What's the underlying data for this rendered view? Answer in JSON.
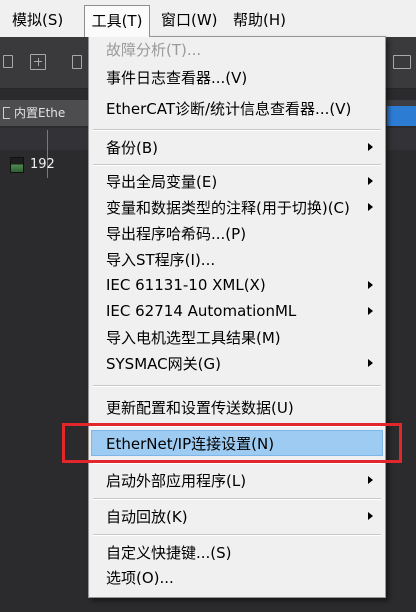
{
  "menubar": {
    "items": [
      {
        "label": "模拟(S)"
      },
      {
        "label": "工具(T)",
        "open": true
      },
      {
        "label": "窗口(W)"
      },
      {
        "label": "帮助(H)"
      }
    ]
  },
  "workspace": {
    "panel_tab_label": "内置Ethe",
    "device_row_text": "192"
  },
  "tools_menu": {
    "items": [
      {
        "label": "故障分析(T)...",
        "disabled": true
      },
      {
        "label": "事件日志查看器...(V)"
      },
      {
        "label": "EtherCAT诊断/统计信息查看器...(V)"
      },
      {
        "label": "备份(B)",
        "submenu": true
      },
      {
        "label": "导出全局变量(E)",
        "submenu": true
      },
      {
        "label": "变量和数据类型的注释(用于切换)(C)",
        "submenu": true
      },
      {
        "label": "导出程序哈希码...(P)"
      },
      {
        "label": "导入ST程序(I)..."
      },
      {
        "label": "IEC 61131-10 XML(X)",
        "submenu": true
      },
      {
        "label": "IEC 62714 AutomationML",
        "submenu": true
      },
      {
        "label": "导入电机选型工具结果(M)"
      },
      {
        "label": "SYSMAC网关(G)",
        "submenu": true
      },
      {
        "label": "更新配置和设置传送数据(U)"
      },
      {
        "label": "EtherNet/IP连接设置(N)",
        "highlighted": true
      },
      {
        "label": "启动外部应用程序(L)",
        "submenu": true
      },
      {
        "label": "自动回放(K)",
        "submenu": true
      },
      {
        "label": "自定义快捷键...(S)"
      },
      {
        "label": "选项(O)..."
      }
    ]
  },
  "icons": {
    "submenu": "submenu-arrow-icon"
  },
  "colors": {
    "menu_background": "#F0F0F0",
    "menu_highlight": "#9DCBF1",
    "disabled_text": "#9A9A9A",
    "workspace_background": "#2B2B2D",
    "annotation_box": "#E3262B"
  }
}
